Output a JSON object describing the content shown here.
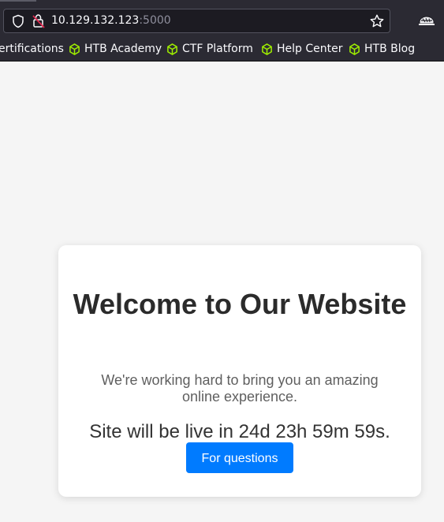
{
  "browser": {
    "url_host": "10.129.132.123",
    "url_port": ":5000",
    "bookmarks": [
      {
        "label": "ertifications"
      },
      {
        "label": "HTB Academy"
      },
      {
        "label": "CTF Platform"
      },
      {
        "label": "Help Center"
      },
      {
        "label": "HTB Blog"
      }
    ],
    "bookmark_icon": "hackthebox-cube-icon",
    "accent_color": "#9fef00"
  },
  "page": {
    "title": "Welcome to Our Website",
    "tagline": "We're working hard to bring you an amazing online experience.",
    "countdown": "Site will be live in 24d 23h 59m 59s.",
    "button_label": "For questions",
    "button_color": "#007bff"
  }
}
